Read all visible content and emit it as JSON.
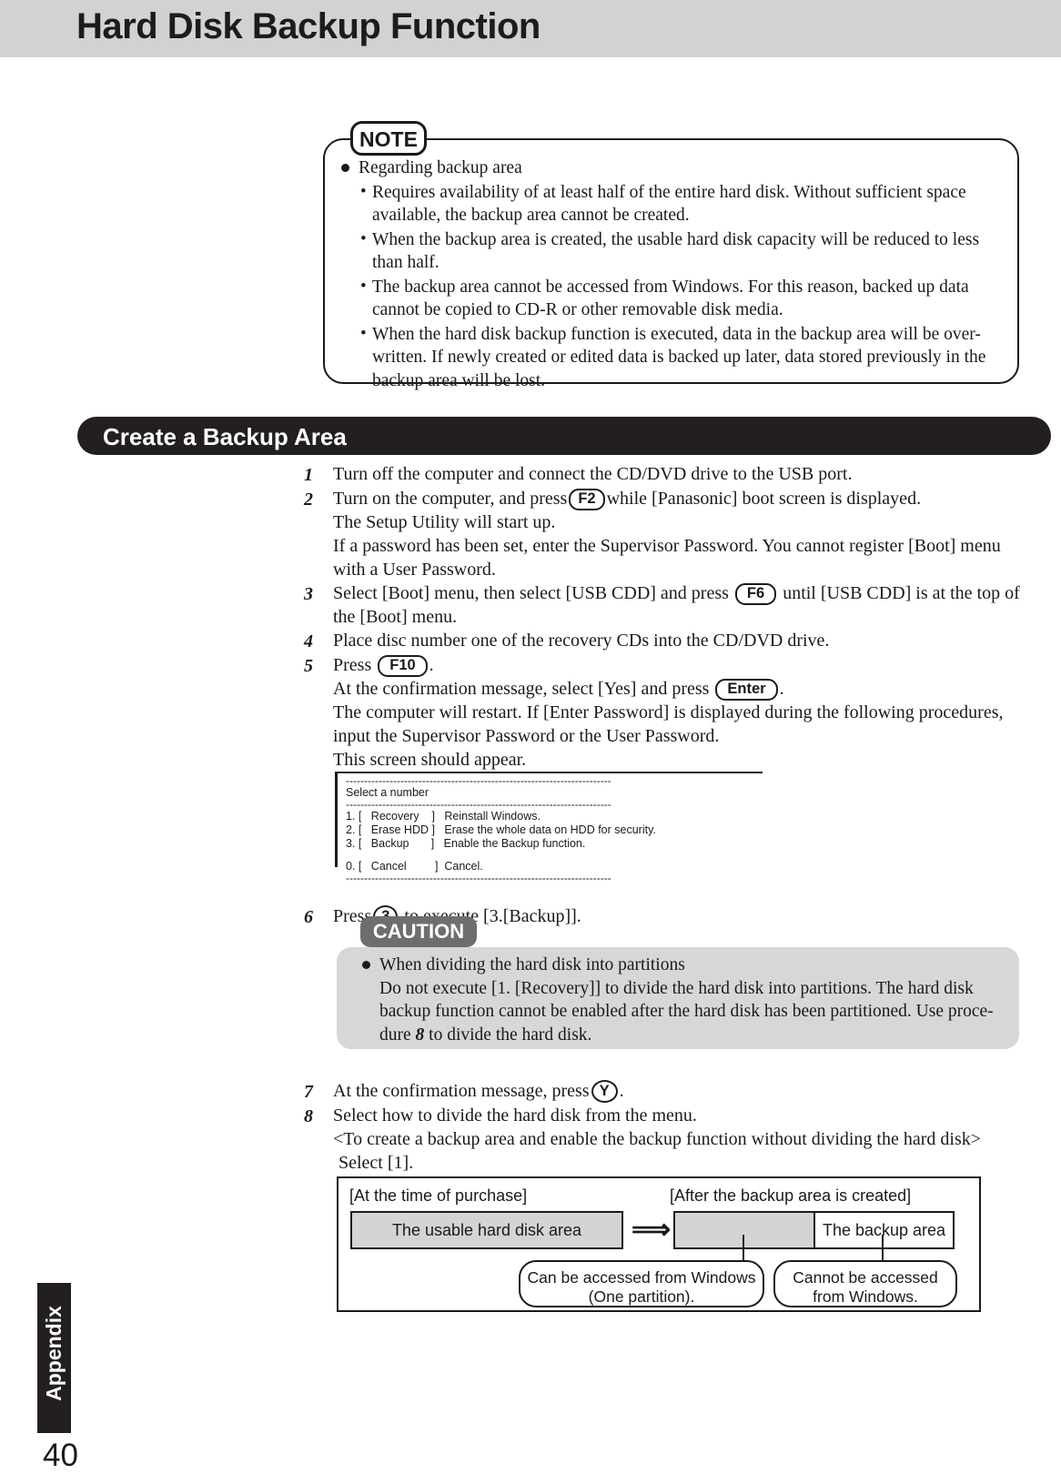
{
  "page": {
    "title": "Hard Disk Backup Function",
    "side_tab": "Appendix",
    "number": "40"
  },
  "note": {
    "badge": "NOTE",
    "heading": "Regarding backup area",
    "items": [
      "Requires availability of at least half of the entire hard disk. Without sufficient space available, the backup area cannot be created.",
      "When the backup area is created, the usable hard disk capacity will be reduced to less than half.",
      "The backup area cannot be accessed from Windows. For this reason, backed up data cannot be copied to CD-R or other removable disk media.",
      "When the hard disk backup function is executed, data in the backup area will be over-written. If newly created or edited data is backed up later, data stored previously in the backup area will be lost."
    ]
  },
  "section": {
    "heading": "Create a Backup Area"
  },
  "steps": {
    "s1": {
      "num": "1",
      "text": "Turn off the computer and connect the CD/DVD drive to the USB port."
    },
    "s2": {
      "num": "2",
      "part_a": "Turn on the computer, and press",
      "key": "F2",
      "part_b": "while [Panasonic] boot screen is displayed.",
      "line2": "The Setup Utility will start up.",
      "line3": "If a password has been set, enter the Supervisor Password. You cannot register [Boot] menu with a User Password."
    },
    "s3": {
      "num": "3",
      "part_a": "Select [Boot] menu, then select [USB CDD] and press",
      "key": "F6",
      "part_b": "until [USB CDD] is at the top of the [Boot] menu."
    },
    "s4": {
      "num": "4",
      "text": "Place disc number one of the recovery CDs into the CD/DVD drive."
    },
    "s5": {
      "num": "5",
      "part_a": "Press",
      "key": "F10",
      "part_b": ".",
      "line2_a": "At the confirmation message, select [Yes] and press",
      "line2_key": "Enter",
      "line2_b": ".",
      "line3": "The computer will restart. If [Enter Password] is displayed during the following procedures, input the Supervisor Password or the User Password.",
      "line4": "This screen should appear."
    },
    "s6": {
      "num": "6",
      "part_a": "Press",
      "key": "3",
      "part_b": "to execute [3.[Backup]]."
    },
    "s7": {
      "num": "7",
      "part_a": "At the confirmation message, press",
      "key": "Y",
      "part_b": "."
    },
    "s8": {
      "num": "8",
      "text": "Select how to divide the hard disk from the menu.",
      "line2": "<To create a backup area and enable the backup function without dividing the hard disk>",
      "line3": "Select [1]."
    }
  },
  "screen_mock": {
    "rule": "-------------------------------------------------------------------------",
    "prompt": "Select a number",
    "options": [
      "1. [   Recovery    ]   Reinstall Windows.",
      "2. [   Erase HDD ]   Erase the whole data on HDD for security.",
      "3. [   Backup       ]   Enable the Backup function."
    ],
    "cancel": "0. [   Cancel         ]  Cancel."
  },
  "caution": {
    "badge": "CAUTION",
    "heading": "When dividing the hard disk into partitions",
    "body_a": "Do not execute [1. [Recovery]] to divide the hard disk into partitions. The hard disk backup function cannot be enabled after the hard disk has been partitioned. Use proce-dure",
    "body_num": "8",
    "body_b": "to divide the hard disk."
  },
  "diagram": {
    "label_left": "[At the time of purchase]",
    "label_right": "[After the backup area is created]",
    "bar_usable": "The usable hard disk area",
    "arrow": "⟹",
    "bar_after_used": "",
    "bar_after_backup": "The backup area",
    "bubble_left": "Can be accessed from Windows (One partition).",
    "bubble_right": "Cannot be accessed from Windows."
  },
  "colors": {
    "header_bg": "#d2d2d2",
    "section_bar": "#231f20",
    "caution_badge": "#6e6e6e",
    "caution_bg": "#d7d7d7",
    "diagram_fill": "#d4d4d4"
  }
}
